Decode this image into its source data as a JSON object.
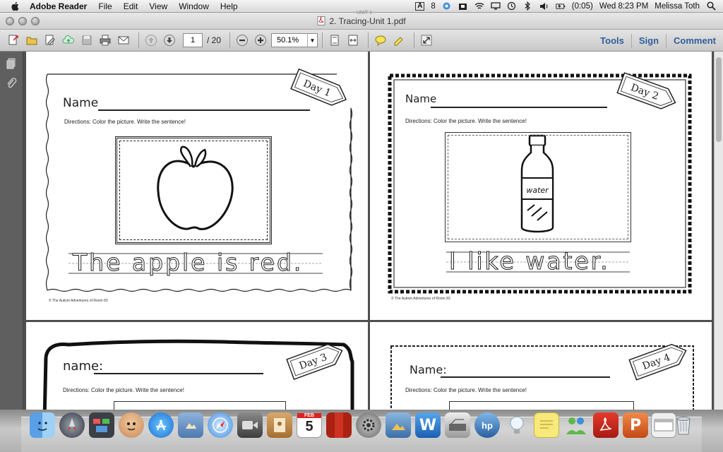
{
  "menubar": {
    "app_name": "Adobe Reader",
    "menus": [
      "File",
      "Edit",
      "View",
      "Window",
      "Help"
    ],
    "status_text": "8",
    "battery": "(0:05)",
    "clock": "Wed 8:23 PM",
    "user": "Melissa Toth"
  },
  "window": {
    "tab_hint": "UNIT 1",
    "title": "2.  Tracing-Unit 1.pdf"
  },
  "toolbar": {
    "page_current": "1",
    "page_total": "/  20",
    "zoom": "50.1%",
    "tools": "Tools",
    "sign": "Sign",
    "comment": "Comment"
  },
  "pages": [
    {
      "name_label": "Name",
      "directions": "Directions: Color the picture.  Write the sentence!",
      "day": "Day 1",
      "sentence": "The apple is red.",
      "copyright": "© The Autism Adventures of Room 83"
    },
    {
      "name_label": "Name",
      "directions": "Directions: Color the picture.  Write the sentence!",
      "day": "Day 2",
      "bottle_label": "water",
      "sentence": "I like water.",
      "copyright": "© The Autism Adventures of Room 83"
    },
    {
      "name_label": "name:",
      "directions": "Directions: Color the picture.  Write the sentence!",
      "day": "Day 3"
    },
    {
      "name_label": "Name:",
      "directions": "Directions: Color the picture.  Write the sentence!",
      "day": "Day 4"
    }
  ],
  "dock": {
    "calendar_day": "5",
    "calendar_month": "FEB"
  }
}
